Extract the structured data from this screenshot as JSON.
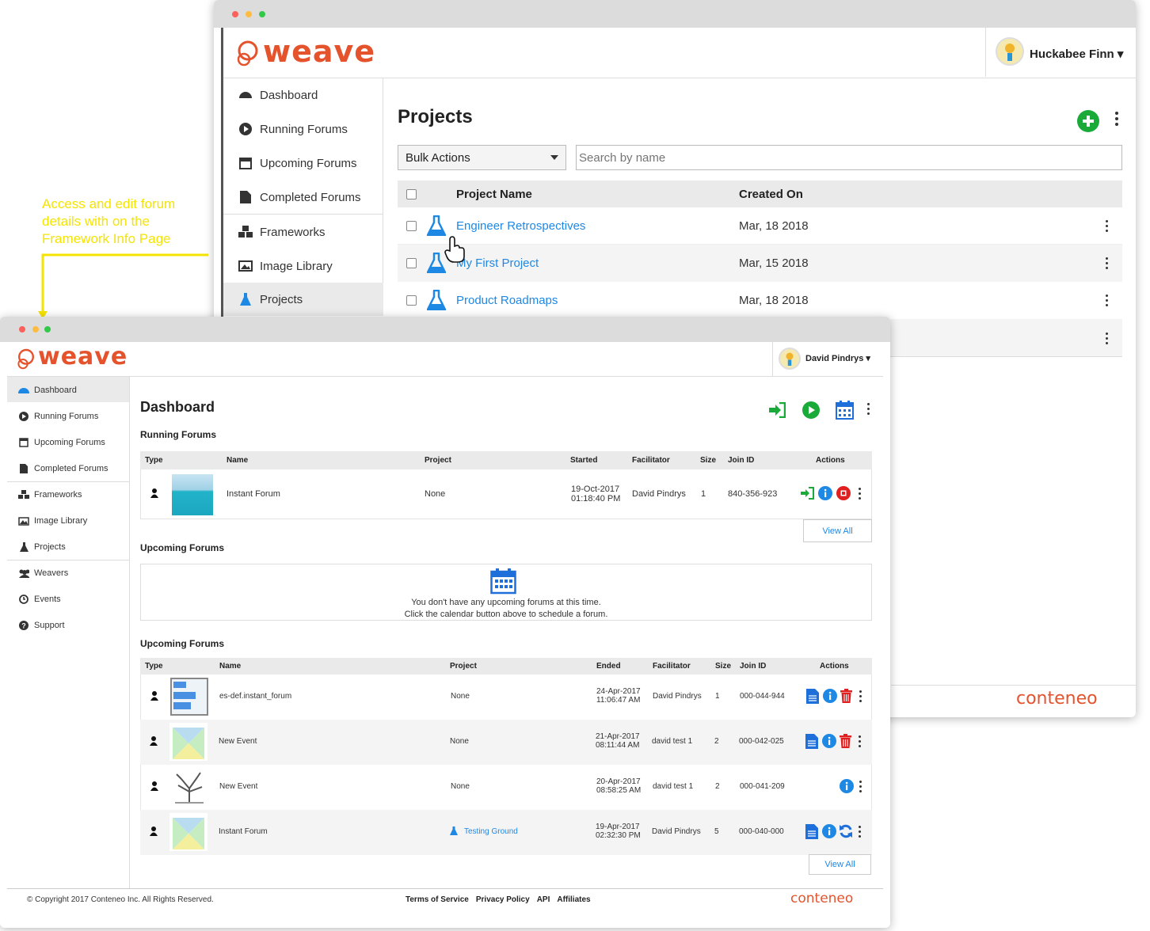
{
  "annotation": {
    "text_lines": [
      "Access and edit forum",
      "details with on the",
      "Framework Info Page"
    ],
    "color": "#f5e400"
  },
  "back_window": {
    "logo": "weave",
    "user": "Huckabee Finn ▾",
    "nav": [
      "Dashboard",
      "Running Forums",
      "Upcoming Forums",
      "Completed Forums",
      "Frameworks",
      "Image Library",
      "Projects"
    ],
    "title": "Projects",
    "bulk_actions": "Bulk Actions",
    "search_placeholder": "Search by name",
    "columns": {
      "name": "Project Name",
      "created": "Created On"
    },
    "rows": [
      {
        "name": "Engineer Retrospectives",
        "created": "Mar, 18 2018"
      },
      {
        "name": "My First Project",
        "created": "Mar, 15 2018"
      },
      {
        "name": "Product Roadmaps",
        "created": "Mar, 18 2018"
      }
    ],
    "brand": "conteneo"
  },
  "front_window": {
    "logo": "weave",
    "user": "David Pindrys ▾",
    "nav": [
      "Dashboard",
      "Running Forums",
      "Upcoming Forums",
      "Completed Forums",
      "Frameworks",
      "Image Library",
      "Projects",
      "Weavers",
      "Events",
      "Support"
    ],
    "title": "Dashboard",
    "running": {
      "heading": "Running Forums",
      "columns": [
        "Type",
        "Name",
        "Project",
        "Started",
        "Facilitator",
        "Size",
        "Join ID",
        "Actions"
      ],
      "rows": [
        {
          "name": "Instant Forum",
          "project": "None",
          "date": "19-Oct-2017",
          "time": "01:18:40 PM",
          "facilitator": "David Pindrys",
          "size": "1",
          "join_id": "840-356-923"
        }
      ],
      "view_all": "View All"
    },
    "upcoming": {
      "heading": "Upcoming Forums",
      "empty_line1": "You don't have any upcoming forums at this time.",
      "empty_line2": "Click the calendar button above to schedule a forum."
    },
    "completed": {
      "heading": "Upcoming Forums",
      "columns": [
        "Type",
        "Name",
        "Project",
        "Ended",
        "Facilitator",
        "Size",
        "Join ID",
        "Actions"
      ],
      "rows": [
        {
          "name": "es-def.instant_forum",
          "project": "None",
          "date": "24-Apr-2017",
          "time": "11:06:47 AM",
          "facilitator": "David Pindrys",
          "size": "1",
          "join_id": "000-044-944"
        },
        {
          "name": "New Event",
          "project": "None",
          "date": "21-Apr-2017",
          "time": "08:11:44 AM",
          "facilitator": "david test 1",
          "size": "2",
          "join_id": "000-042-025"
        },
        {
          "name": "New Event",
          "project": "None",
          "date": "20-Apr-2017",
          "time": "08:58:25 AM",
          "facilitator": "david test 1",
          "size": "2",
          "join_id": "000-041-209"
        },
        {
          "name": "Instant Forum",
          "project": "Testing Ground",
          "date": "19-Apr-2017",
          "time": "02:32:30 PM",
          "facilitator": "David Pindrys",
          "size": "5",
          "join_id": "000-040-000"
        }
      ],
      "view_all": "View All"
    },
    "footer": {
      "copyright": "© Copyright 2017 Conteneo Inc. All Rights Reserved.",
      "links": [
        "Terms of Service",
        "Privacy Policy",
        "API",
        "Affiliates"
      ],
      "brand": "conteneo"
    }
  },
  "colors": {
    "brand_orange": "#e5532d",
    "link_blue": "#1e88e5",
    "green": "#1aaa3a",
    "red": "#e02020"
  }
}
